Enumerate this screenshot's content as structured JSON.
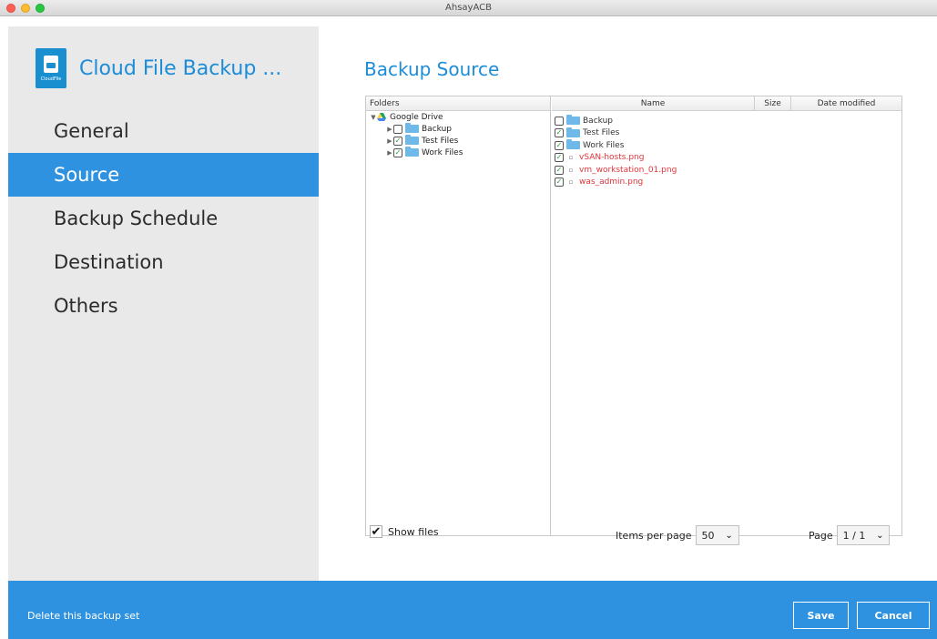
{
  "window": {
    "title": "AhsayACB"
  },
  "sidebar": {
    "app_title": "Cloud File Backup ...",
    "logo_caption": "CloudFile",
    "items": [
      {
        "label": "General",
        "active": false
      },
      {
        "label": "Source",
        "active": true
      },
      {
        "label": "Backup Schedule",
        "active": false
      },
      {
        "label": "Destination",
        "active": false
      },
      {
        "label": "Others",
        "active": false
      }
    ]
  },
  "main": {
    "title": "Backup Source",
    "folders_header": "Folders",
    "columns": {
      "name": "Name",
      "size": "Size",
      "date": "Date modified"
    },
    "tree": {
      "root": {
        "label": "Google Drive",
        "icon": "google-drive-icon"
      },
      "children": [
        {
          "label": "Backup",
          "checked": false
        },
        {
          "label": "Test Files",
          "checked": true
        },
        {
          "label": "Work Files",
          "checked": true
        }
      ]
    },
    "files": [
      {
        "label": "Backup",
        "type": "folder",
        "checked": false,
        "color": "#222222"
      },
      {
        "label": "Test Files",
        "type": "folder",
        "checked": true,
        "color": "#222222"
      },
      {
        "label": "Work Files",
        "type": "folder",
        "checked": true,
        "color": "#222222"
      },
      {
        "label": "vSAN-hosts.png",
        "type": "file",
        "checked": true,
        "color": "#e0333a"
      },
      {
        "label": "vm_workstation_01.png",
        "type": "file",
        "checked": true,
        "color": "#e0333a"
      },
      {
        "label": "was_admin.png",
        "type": "file",
        "checked": true,
        "color": "#e0333a"
      }
    ],
    "show_files": {
      "label": "Show files",
      "checked": true
    },
    "items_per_page": {
      "label": "Items per page",
      "value": "50"
    },
    "page": {
      "label": "Page",
      "value": "1 / 1"
    }
  },
  "footer": {
    "delete_label": "Delete this backup set",
    "save_label": "Save",
    "cancel_label": "Cancel"
  },
  "colors": {
    "accent": "#2f92e0",
    "title_blue": "#1b8dd8",
    "sidebar_bg": "#e9e9e9",
    "missing_file": "#e0333a"
  }
}
